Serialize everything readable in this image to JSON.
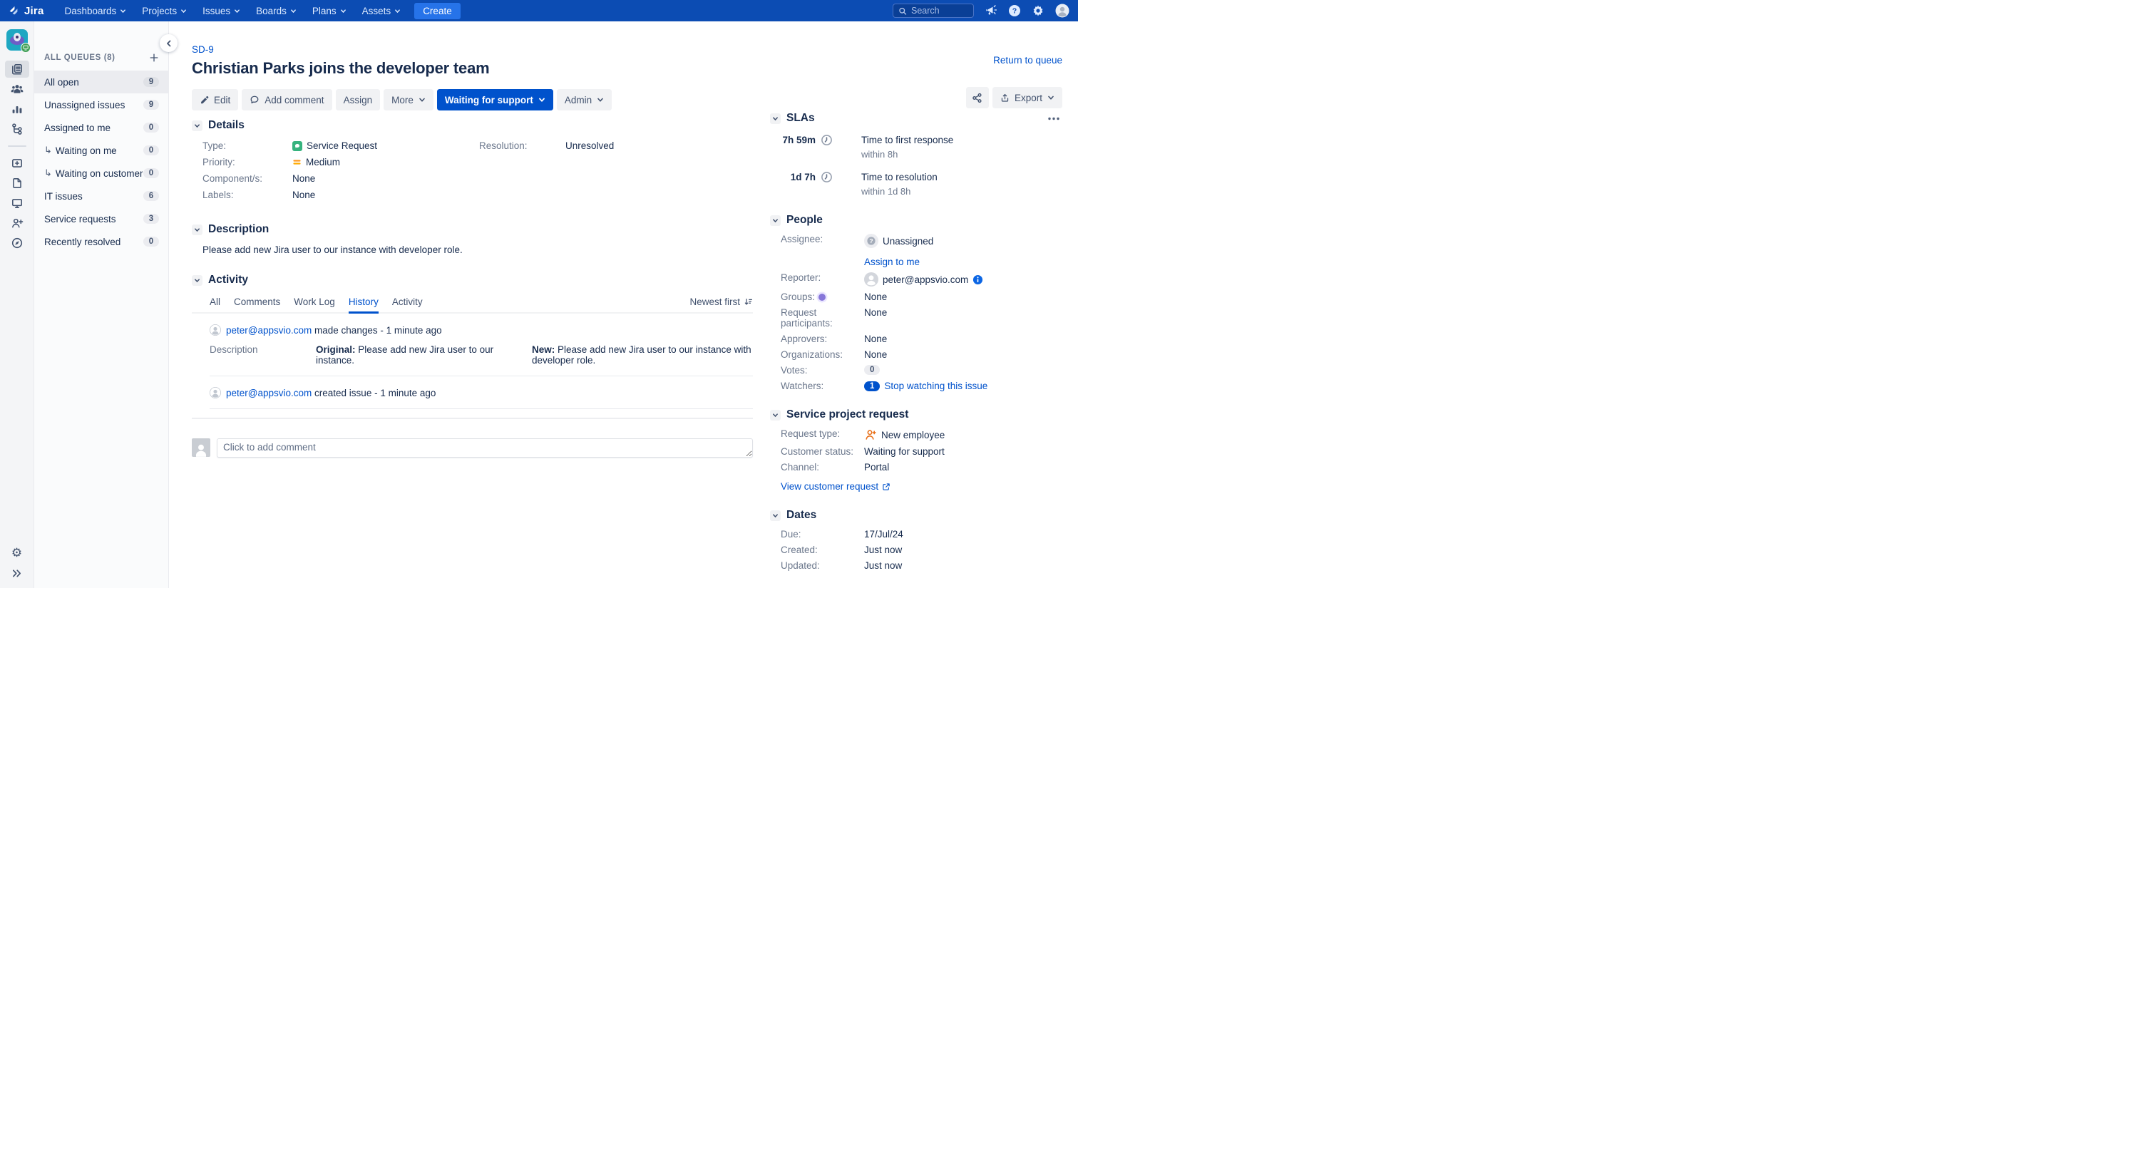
{
  "nav": {
    "logo_text": "Jira",
    "items": [
      "Dashboards",
      "Projects",
      "Issues",
      "Boards",
      "Plans",
      "Assets"
    ],
    "create_label": "Create",
    "search_placeholder": "Search"
  },
  "sidebar": {
    "queues_header": "ALL QUEUES (8)",
    "queues": [
      {
        "label": "All open",
        "count": "9"
      },
      {
        "label": "Unassigned issues",
        "count": "9"
      },
      {
        "label": "Assigned to me",
        "count": "0"
      },
      {
        "label": "Waiting on me",
        "count": "0"
      },
      {
        "label": "Waiting on customer",
        "count": "0"
      },
      {
        "label": "IT issues",
        "count": "6"
      },
      {
        "label": "Service requests",
        "count": "3"
      },
      {
        "label": "Recently resolved",
        "count": "0"
      }
    ]
  },
  "issue": {
    "key": "SD-9",
    "title": "Christian Parks joins the developer team",
    "return_link": "Return to queue",
    "toolbar": {
      "edit": "Edit",
      "add_comment": "Add comment",
      "assign": "Assign",
      "more": "More",
      "status": "Waiting for support",
      "admin": "Admin",
      "export": "Export"
    },
    "details": {
      "heading": "Details",
      "type_label": "Type:",
      "type_value": "Service Request",
      "priority_label": "Priority:",
      "priority_value": "Medium",
      "components_label": "Component/s:",
      "components_value": "None",
      "labels_label": "Labels:",
      "labels_value": "None",
      "resolution_label": "Resolution:",
      "resolution_value": "Unresolved"
    },
    "description": {
      "heading": "Description",
      "text": "Please add new Jira user to our instance with developer role."
    },
    "activity": {
      "heading": "Activity",
      "tabs": [
        "All",
        "Comments",
        "Work Log",
        "History",
        "Activity"
      ],
      "active_tab": "History",
      "sort_label": "Newest first",
      "events": [
        {
          "user": "peter@appsvio.com",
          "action": "made changes - 1 minute ago",
          "field": "Description",
          "original_label": "Original:",
          "original": "Please add new Jira user to our instance.",
          "new_label": "New:",
          "new": "Please add new Jira user to our instance with developer role."
        },
        {
          "user": "peter@appsvio.com",
          "action": "created issue - 1 minute ago"
        }
      ],
      "comment_placeholder": "Click to add comment"
    }
  },
  "panel": {
    "slas": {
      "heading": "SLAs",
      "rows": [
        {
          "time": "7h 59m",
          "name": "Time to first response",
          "goal": "within 8h"
        },
        {
          "time": "1d 7h",
          "name": "Time to resolution",
          "goal": "within 1d 8h"
        }
      ]
    },
    "people": {
      "heading": "People",
      "assignee_label": "Assignee:",
      "assignee_value": "Unassigned",
      "assign_to_me": "Assign to me",
      "reporter_label": "Reporter:",
      "reporter_value": "peter@appsvio.com",
      "groups_label": "Groups:",
      "groups_value": "None",
      "participants_label": "Request participants:",
      "participants_value": "None",
      "approvers_label": "Approvers:",
      "approvers_value": "None",
      "organizations_label": "Organizations:",
      "organizations_value": "None",
      "votes_label": "Votes:",
      "votes_value": "0",
      "watchers_label": "Watchers:",
      "watchers_count": "1",
      "watchers_link": "Stop watching this issue"
    },
    "request": {
      "heading": "Service project request",
      "type_label": "Request type:",
      "type_value": "New employee",
      "status_label": "Customer status:",
      "status_value": "Waiting for support",
      "channel_label": "Channel:",
      "channel_value": "Portal",
      "view_link": "View customer request"
    },
    "dates": {
      "heading": "Dates",
      "due_label": "Due:",
      "due_value": "17/Jul/24",
      "created_label": "Created:",
      "created_value": "Just now",
      "updated_label": "Updated:",
      "updated_value": "Just now"
    }
  },
  "colors": {
    "nav_background": "#0C4CB3",
    "create_button": "#2673E9",
    "primary_button": "#0052CC",
    "link": "#0052CC",
    "text": "#172B4D",
    "label_gray": "#6B778C",
    "type_icon_green": "#36B37E",
    "priority_orange": "#FFAB00",
    "request_type_orange": "#E8701A",
    "groups_purple": "#8777D9",
    "selected_row": "#EBECF0"
  },
  "icons": {
    "jira-logo": "angled diamond mark",
    "chevron-down-icon": "▾",
    "search-icon": "magnifier",
    "megaphone-icon": "announcement horn",
    "help-icon": "? in circle",
    "gear-icon": "⚙",
    "avatar-icon": "person silhouette",
    "queues-icon": "stacked pages",
    "customers-icon": "three people",
    "reports-icon": "bar chart",
    "escalations-icon": "node tree",
    "raise-request-icon": "card with plus",
    "knowledge-base-icon": "document page",
    "channels-icon": "monitor",
    "invite-team-icon": "person with plus",
    "apps-icon": "compass",
    "edit-icon": "pencil",
    "comment-icon": "speech bubble",
    "share-icon": "connected nodes",
    "export-icon": "arrow up from tray",
    "sort-icon": "arrow down with bars",
    "clock-icon": "clock face",
    "info-icon": "i in blue circle",
    "external-link-icon": "box with arrow",
    "more-icon": "three dots"
  }
}
